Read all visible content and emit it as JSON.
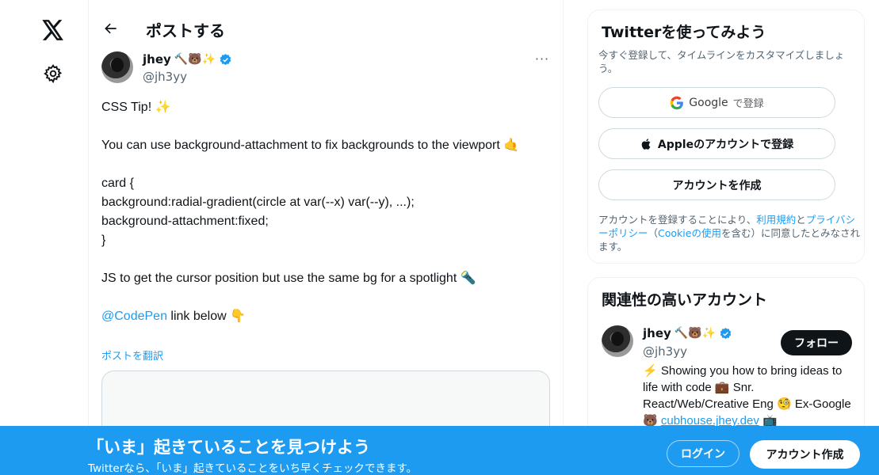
{
  "header": {
    "title": "ポストする"
  },
  "post": {
    "author_name": "jhey",
    "author_emojis": "🔨🐻✨",
    "author_handle": "@jh3yy",
    "more_label": "···",
    "body": "CSS Tip! ✨\n\nYou can use background-attachment to fix backgrounds to the viewport 🤙\n\ncard {\nbackground:radial-gradient(circle at var(--x) var(--y), ...);\nbackground-attachment:fixed;\n}\n\nJS to get the cursor position but use the same bg for a spotlight 🔦\n\n",
    "mention": "@CodePen",
    "mention_tail": " link below 👇",
    "translate": "ポストを翻訳"
  },
  "signup_card": {
    "title": "Twitterを使ってみよう",
    "desc": "今すぐ登録して、タイムラインをカスタマイズしましょう。",
    "google_label": "Google",
    "google_suffix": "で登録",
    "apple_label": "Appleのアカウントで登録",
    "create_label": "アカウントを作成",
    "legal_1": "アカウントを登録することにより、",
    "legal_terms": "利用規約",
    "legal_and": "と",
    "legal_privacy": "プライバシーポリシー",
    "legal_2": "（",
    "legal_cookie": "Cookieの使用",
    "legal_3": "を含む）に同意したとみなされます。"
  },
  "recommend_card": {
    "title": "関連性の高いアカウント",
    "name": "jhey",
    "emojis": "🔨🐻✨",
    "handle": "@jh3yy",
    "follow_label": "フォロー",
    "bio_1": "⚡ Showing you how to bring ideas to life with code 💼 Snr. React/Web/Creative Eng 🧐 Ex-Google 🐻 ",
    "bio_link": "cubhouse.jhey.dev",
    "bio_2": " 📺"
  },
  "banner": {
    "title": "「いま」起きていることを見つけよう",
    "subtitle": "Twitterなら、「いま」起きていることをいち早くチェックできます。",
    "login_label": "ログイン",
    "signup_label": "アカウント作成"
  },
  "colors": {
    "accent": "#1d9bf0",
    "text": "#0f1419",
    "secondary": "#536471"
  },
  "icons": {
    "logo": "x-logo-icon",
    "settings": "gear-icon",
    "back": "arrow-left-icon",
    "verified": "verified-badge-icon"
  }
}
